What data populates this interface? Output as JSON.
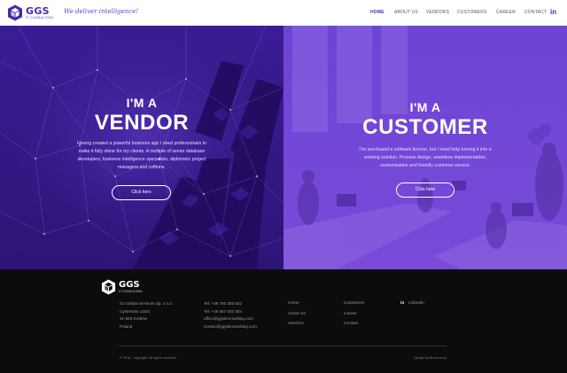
{
  "header": {
    "logo_text": "GGS",
    "logo_sub": "IT CONSULTING",
    "tagline": "We deliver intelligence!",
    "nav": [
      {
        "label": "HOME",
        "active": true
      },
      {
        "label": "ABOUT US",
        "active": false
      },
      {
        "label": "VENDORS",
        "active": false
      },
      {
        "label": "CUSTOMERS",
        "active": false
      },
      {
        "label": "CAREER",
        "active": false
      },
      {
        "label": "CONTACT",
        "active": false
      }
    ],
    "linkedin_icon": "in"
  },
  "vendor": {
    "small": "I'M A",
    "big": "VENDOR",
    "desc": "Having created a powerful business app I need professionals to make it fully shine for my clients. A multiple of senior database developers, business intelligence specialists, diplomatic project managers and coffeine.",
    "button": "Click here"
  },
  "customer": {
    "small": "I'M A",
    "big": "CUSTOMER",
    "desc": "I've purchased a software licence, but I need help turning it into a working solution. Process design, seamless implementation, customization and friendly customer service.",
    "button": "Click here"
  },
  "footer": {
    "logo_text": "GGS",
    "logo_sub": "IT CONSULTING",
    "address": [
      "Go Global Services Sp. z o.o.",
      "Cystersów 13a/3",
      "31-553 Kraków",
      "Poland"
    ],
    "contact": [
      "Tel: +48 790 355 632",
      "Tel: +48 667 062 084",
      "office@ggsitconsulting.com",
      "contact@ggsitconsulting.com"
    ],
    "links_col1": [
      "Home",
      "About Us",
      "Vendors"
    ],
    "links_col2": [
      "Customers",
      "Career",
      "Contact"
    ],
    "linkedin_label": "Linkedin",
    "linkedin_icon": "in",
    "copyright": "© 2016 · copyright. All rights reserved.",
    "design_by": "Design by Brouscio.pl"
  },
  "colors": {
    "brand": "#4a2aa6",
    "vendor_bg": "#2d1476",
    "customer_bg": "#7a4ad8",
    "footer_bg": "#0c0c0c"
  }
}
